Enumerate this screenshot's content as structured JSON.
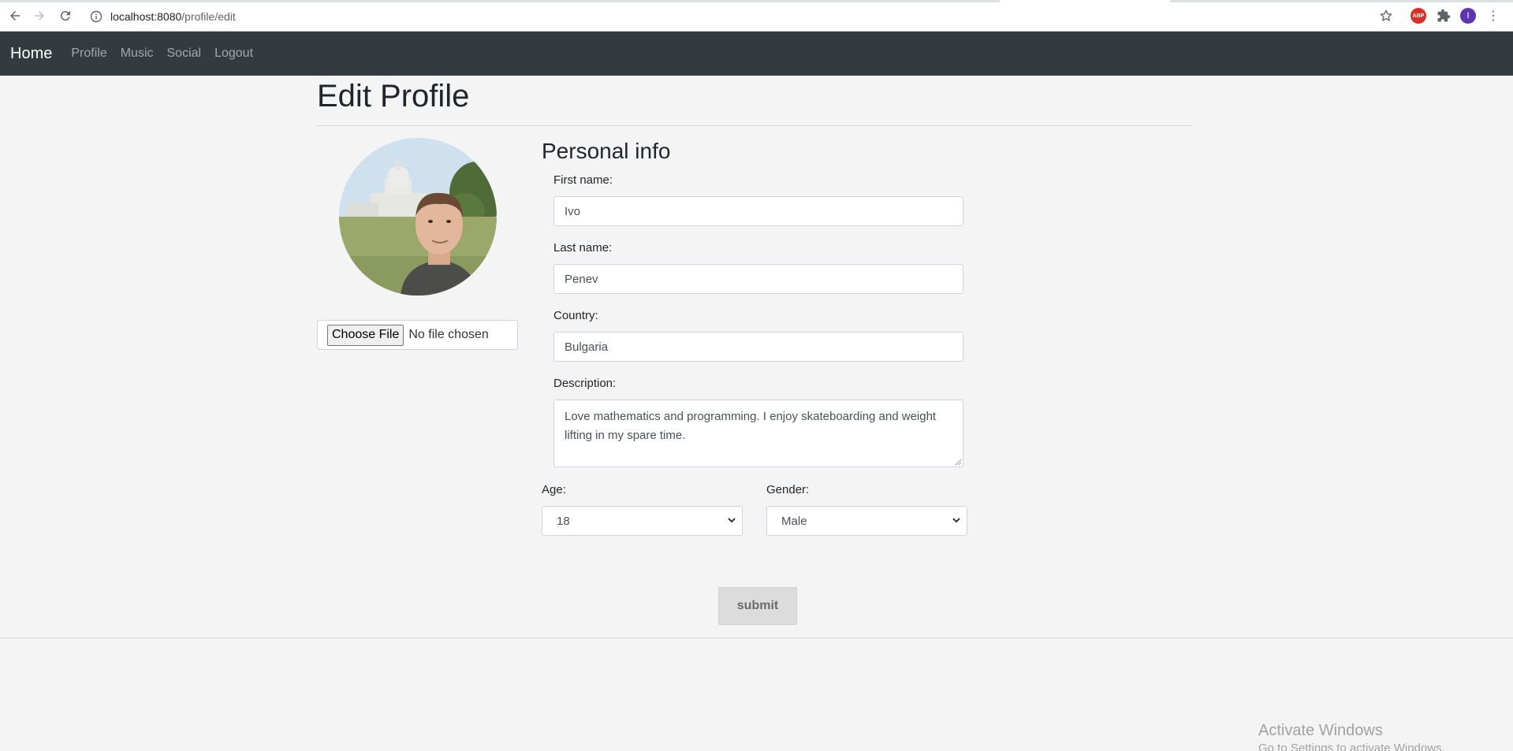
{
  "browser": {
    "url_host": "localhost:8080",
    "url_path": "/profile/edit",
    "extension_abp_label": "ABP",
    "profile_initial": "I"
  },
  "navbar": {
    "brand": "Home",
    "links": [
      "Profile",
      "Music",
      "Social",
      "Logout"
    ]
  },
  "page": {
    "title": "Edit Profile",
    "file_input": {
      "button_label": "Choose File",
      "status": "No file chosen"
    },
    "section_title": "Personal info",
    "first_name": {
      "label": "First name:",
      "value": "Ivo"
    },
    "last_name": {
      "label": "Last name:",
      "value": "Penev"
    },
    "country": {
      "label": "Country:",
      "value": "Bulgaria"
    },
    "description": {
      "label": "Description:",
      "value": "Love mathematics and programming. I enjoy skateboarding and weight lifting in my spare time."
    },
    "age": {
      "label": "Age:",
      "value": "18"
    },
    "gender": {
      "label": "Gender:",
      "value": "Male"
    },
    "submit_label": "submit"
  },
  "watermark": {
    "line1": "Activate Windows",
    "line2": "Go to Settings to activate Windows."
  },
  "colors": {
    "navbar_bg": "#343a40",
    "page_bg": "#f4f4f4",
    "submit_bg": "#dcdcdc"
  }
}
